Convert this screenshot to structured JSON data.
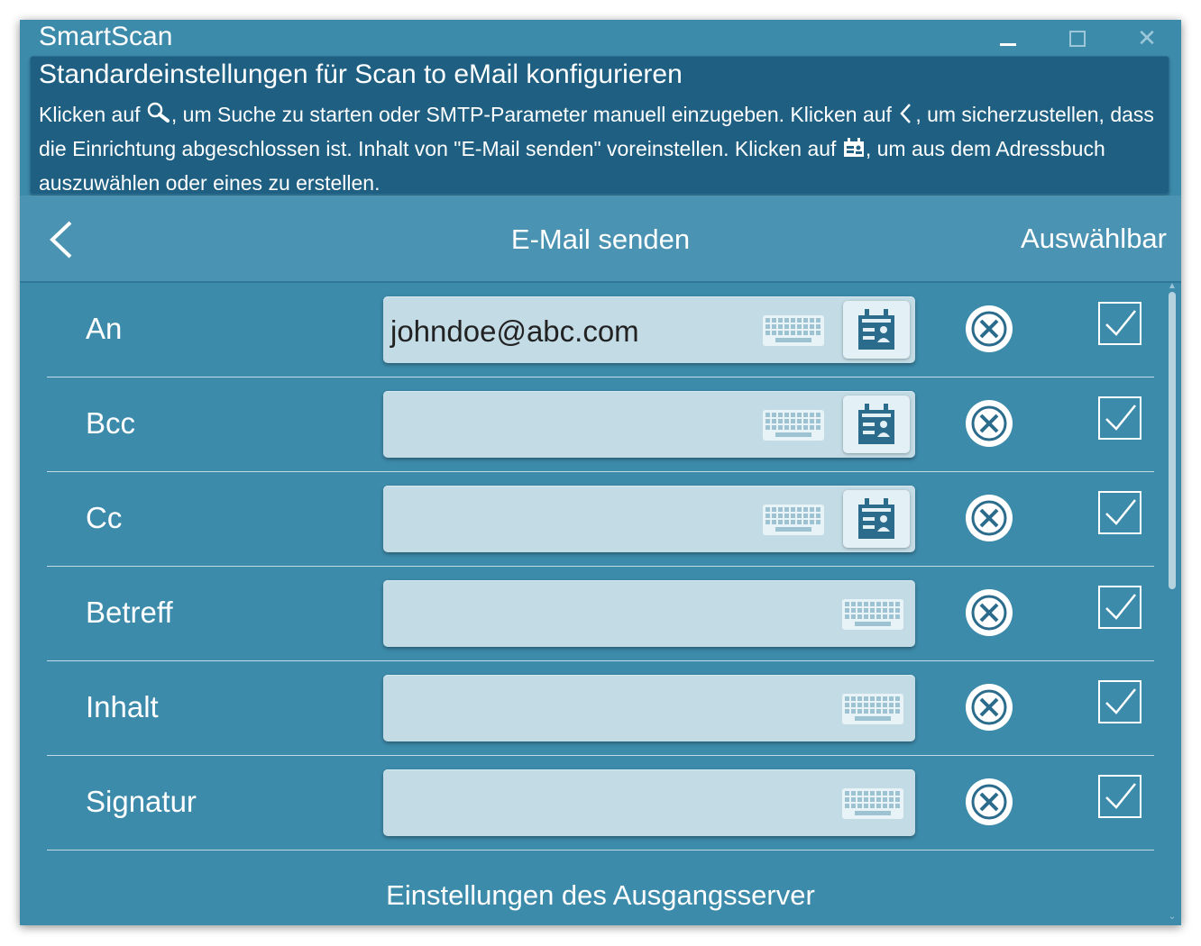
{
  "window": {
    "title": "SmartScan",
    "controls": {
      "minimize": "minimize",
      "maximize": "maximize",
      "close": "✕"
    }
  },
  "info": {
    "title": "Standardeinstellungen für Scan to eMail konfigurieren",
    "text_1": "Klicken auf ",
    "text_2": ", um Suche zu starten oder SMTP-Parameter manuell einzugeben. Klicken auf ",
    "text_3": ", um sicherzustellen, dass die Einrichtung abgeschlossen ist. Inhalt von \"E-Mail senden\" voreinstellen. Klicken auf ",
    "text_4": ", um aus dem Adressbuch auszuwählen oder eines zu erstellen."
  },
  "header": {
    "title": "E-Mail senden",
    "right_label": "Auswählbar"
  },
  "rows": [
    {
      "label": "An",
      "value": "johndoe@abc.com",
      "address_book": true,
      "checked": true
    },
    {
      "label": "Bcc",
      "value": "",
      "address_book": true,
      "checked": true
    },
    {
      "label": "Cc",
      "value": "",
      "address_book": true,
      "checked": true
    },
    {
      "label": "Betreff",
      "value": "",
      "address_book": false,
      "checked": true
    },
    {
      "label": "Inhalt",
      "value": "",
      "address_book": false,
      "checked": true
    },
    {
      "label": "Signatur",
      "value": "",
      "address_book": false,
      "checked": true
    }
  ],
  "footer": {
    "section_title": "Einstellungen des Ausgangsserver"
  },
  "icons": {
    "search": "search-icon",
    "back": "chevron-left-icon",
    "address_book": "address-book-icon",
    "keyboard": "keyboard-icon",
    "clear": "clear-x-icon",
    "checkbox": "checkbox-checked-icon"
  },
  "colors": {
    "window_bg": "#3d8bab",
    "info_bg": "#1e5f82",
    "header_bg": "#4a93b2",
    "field_bg": "#c2dbe5",
    "text": "#ffffff"
  }
}
